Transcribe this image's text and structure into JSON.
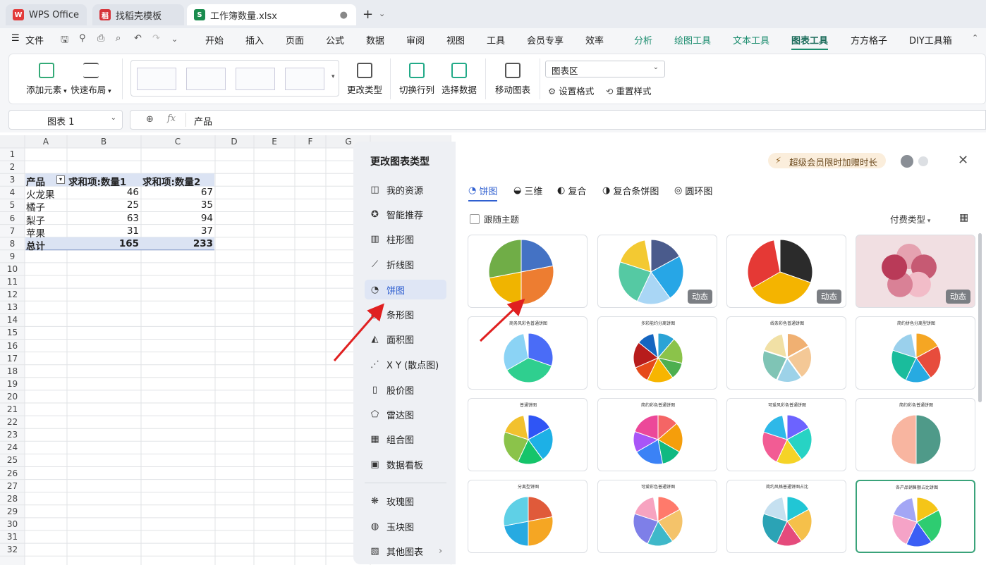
{
  "tabs": [
    {
      "label": "WPS Office",
      "icon": "W",
      "color": "#e23b3b"
    },
    {
      "label": "找稻壳模板",
      "icon": "稻",
      "color": "#d6343a"
    },
    {
      "label": "工作簿数量.xlsx",
      "icon": "S",
      "color": "#1a8c4e"
    }
  ],
  "menu": {
    "file": "文件",
    "items": [
      "开始",
      "插入",
      "页面",
      "公式",
      "数据",
      "审阅",
      "视图",
      "工具",
      "会员专享",
      "效率"
    ],
    "context_items": [
      "分析",
      "绘图工具",
      "文本工具",
      "图表工具",
      "方方格子",
      "DIY工具箱"
    ],
    "active": "图表工具"
  },
  "ribbon": {
    "add_element": "添加元素",
    "quick_layout": "快速布局",
    "change_type": "更改类型",
    "switch_rowcol": "切换行列",
    "select_data": "选择数据",
    "move_chart": "移动图表",
    "area_select": "图表区",
    "set_format": "设置格式",
    "reset_style": "重置样式"
  },
  "formula": {
    "name_box": "图表 1",
    "content": "产品",
    "fx": "fx"
  },
  "sheet": {
    "cols": [
      "A",
      "B",
      "C",
      "D",
      "E",
      "F",
      "G"
    ],
    "rows": [
      "1",
      "2",
      "3",
      "4",
      "5",
      "6",
      "7",
      "8",
      "9",
      "10",
      "11",
      "12",
      "13",
      "14",
      "15",
      "16",
      "17",
      "18",
      "19",
      "20",
      "21",
      "22",
      "23",
      "24",
      "25",
      "26",
      "27",
      "28",
      "29",
      "30",
      "31",
      "32"
    ],
    "header": [
      "产品",
      "求和项:数量1",
      "求和项:数量2"
    ],
    "data": [
      [
        "火龙果",
        "46",
        "67"
      ],
      [
        "橘子",
        "25",
        "35"
      ],
      [
        "梨子",
        "63",
        "94"
      ],
      [
        "苹果",
        "31",
        "37"
      ]
    ],
    "total": [
      "总计",
      "165",
      "233"
    ]
  },
  "dialog": {
    "title": "更改图表类型",
    "promo": "超级会员限时加赠时长",
    "side": [
      "我的资源",
      "智能推荐",
      "柱形图",
      "折线图",
      "饼图",
      "条形图",
      "面积图",
      "X Y (散点图)",
      "股价图",
      "雷达图",
      "组合图",
      "数据看板",
      "玫瑰图",
      "玉块图",
      "其他图表"
    ],
    "active": "饼图",
    "subtabs": [
      "饼图",
      "三维",
      "复合",
      "复合条饼图",
      "圆环图"
    ],
    "follow_theme": "跟随主题",
    "pay_type": "付费类型",
    "badge": "动态",
    "card_titles": [
      "商务风彩色普通饼图",
      "多彩能约分离饼图",
      "线条彩色普通饼图",
      "简约拼色分离型饼图",
      "普通饼图",
      "简约彩色普通饼图",
      "可爱风彩色普通饼图",
      "简约彩色普通饼图",
      "分离型饼图",
      "可爱彩色普通饼图",
      "简约风格普通饼图占比",
      "各产品销售额占比饼图"
    ]
  }
}
